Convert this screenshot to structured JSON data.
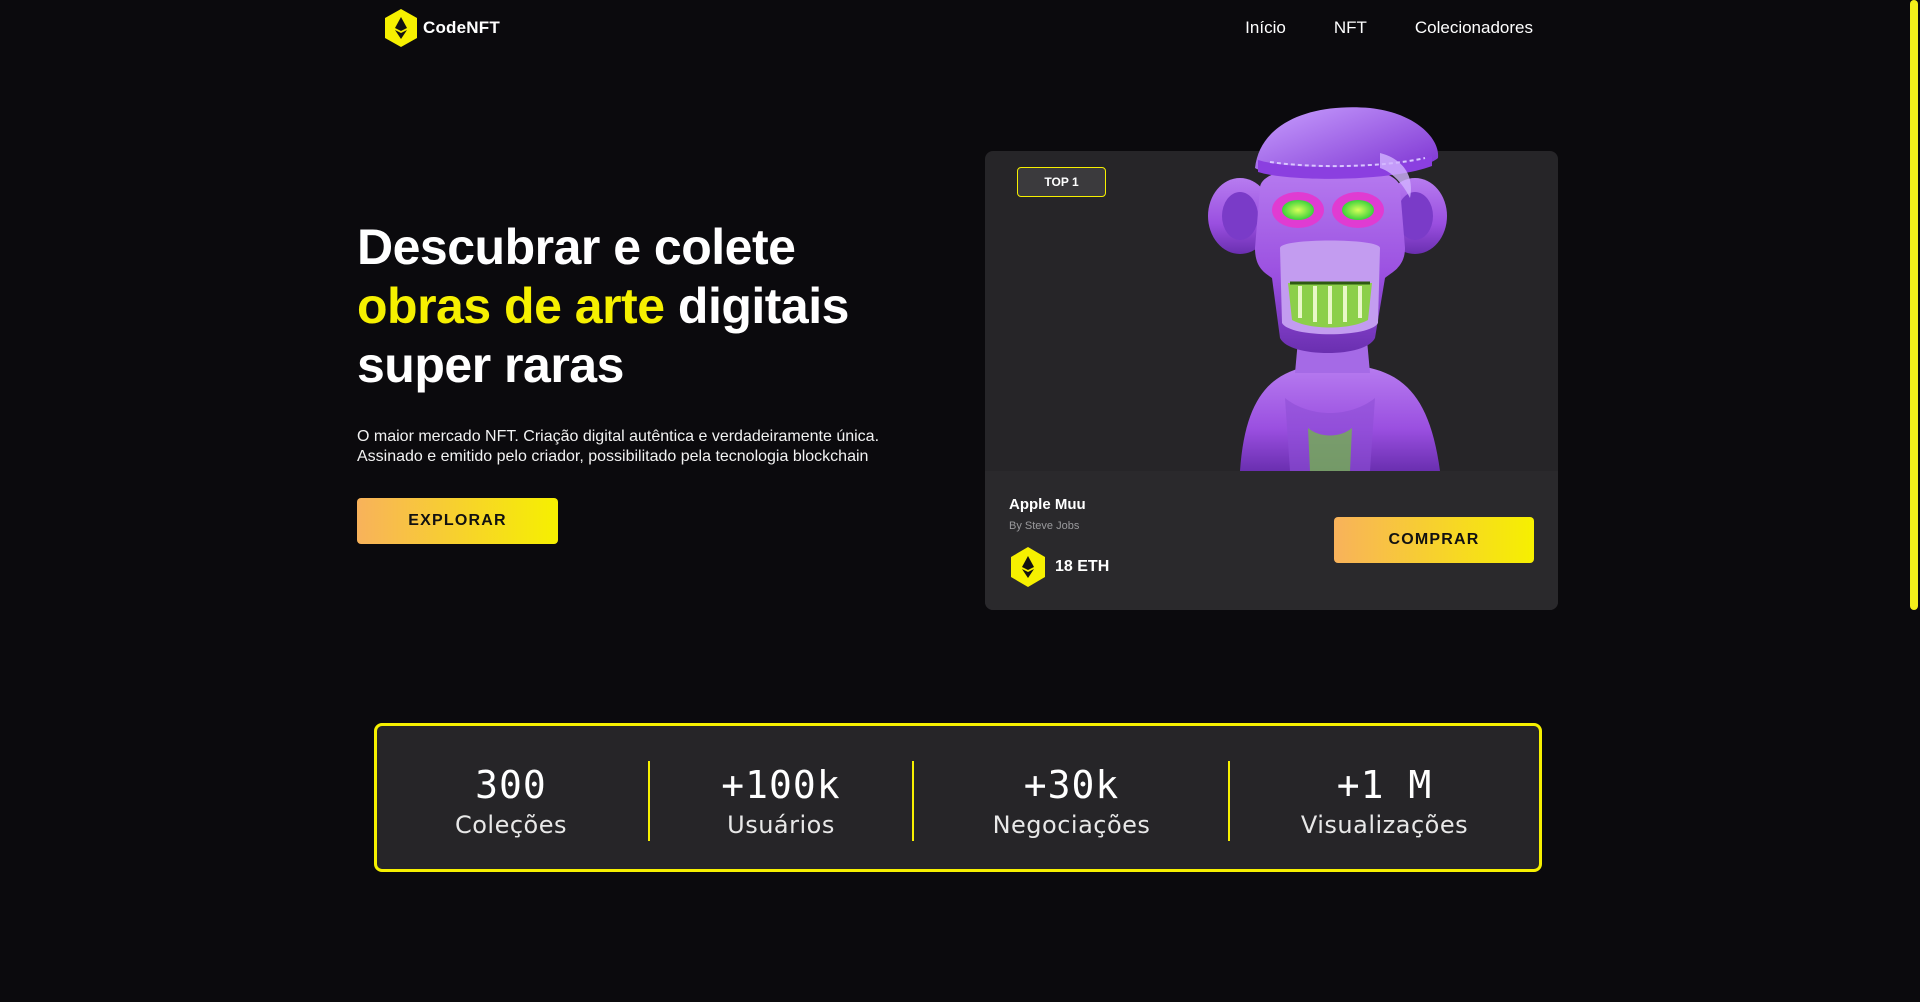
{
  "header": {
    "logo_text": "CodeNFT",
    "nav": [
      "Início",
      "NFT",
      "Colecionadores"
    ]
  },
  "hero": {
    "title_line1": "Descubrar e colete",
    "title_highlight": "obras de arte",
    "title_line2_rest": " digitais",
    "title_line3": "super raras",
    "desc_line1": "O maior mercado NFT. Criação digital autêntica e verdadeiramente única.",
    "desc_line2": "Assinado e emitido pelo criador, possibilitado pela tecnologia blockchain",
    "explore_label": "EXPLORAR"
  },
  "card": {
    "badge": "TOP 1",
    "name": "Apple Muu",
    "author": "By Steve Jobs",
    "price": "18 ETH",
    "buy_label": "COMPRAR"
  },
  "stats": [
    {
      "value": "300",
      "label": "Coleções"
    },
    {
      "value": "+100k",
      "label": "Usuários"
    },
    {
      "value": "+30k",
      "label": "Negociações"
    },
    {
      "value": "+1 M",
      "label": "Visualizações"
    }
  ],
  "colors": {
    "accent": "#f6f000",
    "gradient_start": "#f8b25b",
    "background": "#0b0a0d",
    "card": "#262528"
  }
}
